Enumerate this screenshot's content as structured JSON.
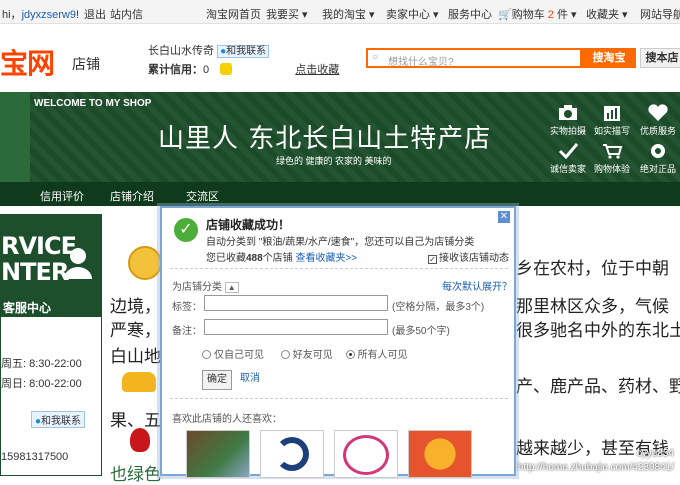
{
  "topbar": {
    "greeting": "hi，",
    "username": "jdyxzserw9",
    "greeting_end": "!",
    "logout": "退出",
    "messages": "站内信",
    "links": [
      "淘宝网首页",
      "我要买",
      "我的淘宝",
      "卖家中心",
      "服务中心"
    ],
    "cart_label": "购物车",
    "cart_count": "2",
    "cart_unit": "件",
    "favorites": "收藏夹",
    "site_nav": "网站导航"
  },
  "header": {
    "logo": "宝网",
    "logo_sub": "店铺",
    "shop_name": "长白山水传奇",
    "contact": "和我联系",
    "credit_label": "累计信用：",
    "credit_value": "0",
    "favorite_link": "点击收藏",
    "search_placeholder": "想找什么宝贝?",
    "search_taobao": "搜淘宝",
    "search_shop": "搜本店"
  },
  "banner": {
    "welcome": "WELCOME TO MY SHOP",
    "title": "山里人  东北长白山土特产店",
    "subtitle": "绿色的  健康的  农家的  美味的",
    "features": [
      "实物拍摄",
      "如实描写",
      "优质服务",
      "诚信卖家",
      "购物体验",
      "绝对正品"
    ]
  },
  "nav": {
    "items": [
      "信用评价",
      "店铺介绍",
      "交流区"
    ]
  },
  "left": {
    "service_title_1": "RVICE",
    "service_title_2": "NTER",
    "service_cn": "客服中心",
    "hours": [
      "周五: 8:30-22:00",
      "周日: 8:00-22:00"
    ],
    "contact": "和我联系",
    "phone": "15981317500"
  },
  "main": {
    "lines": [
      "乡在农村，位于中朝",
      "边境，",
      "那里林区众多，气候",
      "严寒，",
      "很多驰名中外的东北土",
      "白山地",
      "产、鹿产品、药材、野",
      "果、五",
      "越来越少，甚至有钱",
      "也绿色"
    ]
  },
  "dialog": {
    "title": "店铺收藏成功！",
    "desc": "自动分类到 \"粮油/蔬果/水产/速食\"，您还可以自己为店铺分类",
    "stat_prefix": "您已收藏",
    "stat_count": "488",
    "stat_suffix": "个店铺",
    "view_link": "查看收藏夹>>",
    "subscribe": "接收该店铺动态",
    "category_label": "为店铺分类",
    "expand_link": "每次默认展开？",
    "tag_label": "标签：",
    "tag_hint": "(空格分隔，最多3个)",
    "note_label": "备注：",
    "note_hint": "(最多50个字)",
    "visibility": [
      "仅自己可见",
      "好友可见",
      "所有人可见"
    ],
    "confirm": "确定",
    "cancel": "取消",
    "also_like": "喜欢此店铺的人还喜欢："
  },
  "watermark": {
    "user": "cyyu854",
    "url": "http://home.zhubajie.com/4230841/"
  }
}
